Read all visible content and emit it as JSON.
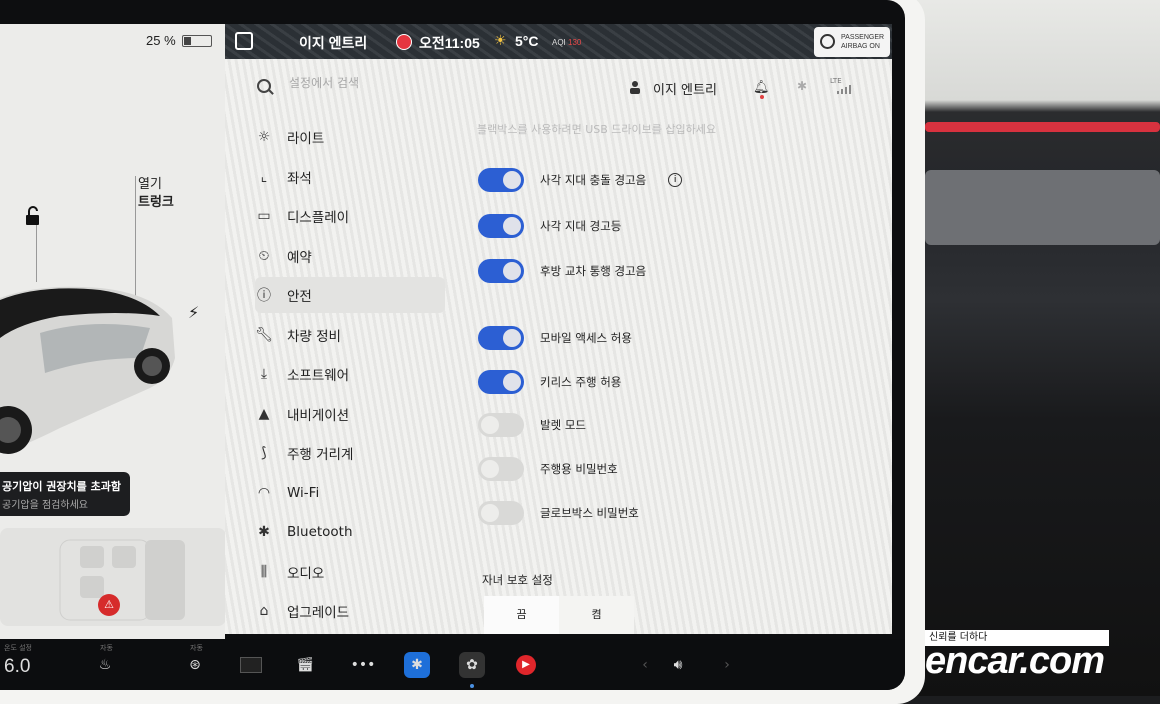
{
  "status_bar": {
    "battery_percent": "25 %",
    "battery_level": 0.25,
    "profile_name": "이지 엔트리",
    "time": "오전11:05",
    "temperature": "5°C",
    "aqi_label": "AQI",
    "aqi_value": "130",
    "airbag_line1": "PASSENGER",
    "airbag_line2": "AIRBAG ON"
  },
  "car_panel": {
    "trunk_label": "열기",
    "trunk_name": "트렁크",
    "alert_title": "공기압이 권장치를 초과함",
    "alert_sub": "공기압을 점검하세요"
  },
  "settings": {
    "search_placeholder": "설정에서 검색",
    "profile_name": "이지 엔트리",
    "lte_label": "LTE",
    "nav_items": [
      {
        "label": "라이트",
        "icon": "light-icon"
      },
      {
        "label": "좌석",
        "icon": "seat-icon"
      },
      {
        "label": "디스플레이",
        "icon": "display-icon"
      },
      {
        "label": "예약",
        "icon": "schedule-icon"
      },
      {
        "label": "안전",
        "icon": "safety-icon"
      },
      {
        "label": "차량 정비",
        "icon": "wrench-icon"
      },
      {
        "label": "소프트웨어",
        "icon": "download-icon"
      },
      {
        "label": "내비게이션",
        "icon": "navigation-icon"
      },
      {
        "label": "주행 거리계",
        "icon": "trip-icon"
      },
      {
        "label": "Wi-Fi",
        "icon": "wifi-icon"
      },
      {
        "label": "Bluetooth",
        "icon": "bluetooth-icon"
      },
      {
        "label": "오디오",
        "icon": "audio-icon"
      },
      {
        "label": "업그레이드",
        "icon": "upgrade-icon"
      }
    ],
    "content_hint": "블랙박스를 사용하려면 USB 드라이브를 삽입하세요",
    "toggles": [
      {
        "label": "사각 지대 충돌 경고음",
        "on": true,
        "info": true
      },
      {
        "label": "사각 지대 경고등",
        "on": true
      },
      {
        "label": "후방 교차 통행 경고음",
        "on": true
      },
      {
        "label": "모바일 액세스 허용",
        "on": true
      },
      {
        "label": "키리스 주행 허용",
        "on": true
      },
      {
        "label": "발렛 모드",
        "on": false
      },
      {
        "label": "주행용 비밀번호",
        "on": false
      },
      {
        "label": "글로브박스 비밀번호",
        "on": false
      }
    ],
    "child_lock_title": "자녀 보호 설정",
    "child_lock_options": [
      "끔",
      "켬"
    ]
  },
  "dock": {
    "temperature": "6.0",
    "label_set": "온도 설정",
    "label_auto1": "자동",
    "label_auto2": "자동"
  },
  "watermark": {
    "tagline": "신뢰를 더하다",
    "brand": "encar.com"
  },
  "colors": {
    "toggle_on": "#2c5fd3",
    "alert_red": "#e53640"
  }
}
